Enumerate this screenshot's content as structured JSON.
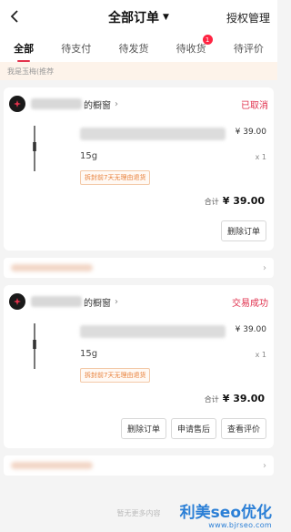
{
  "header": {
    "title": "全部订单",
    "auth_label": "授权管理"
  },
  "tabs": [
    {
      "label": "全部",
      "active": true
    },
    {
      "label": "待支付"
    },
    {
      "label": "待发货"
    },
    {
      "label": "待收货",
      "badge": "1"
    },
    {
      "label": "待评价"
    }
  ],
  "promo": {
    "text": "我是玉梅(推荐"
  },
  "orders": [
    {
      "shop_suffix": "的橱窗",
      "status": "已取消",
      "price": "¥ 39.00",
      "spec": "15g",
      "qty": "x 1",
      "tag": "拆封前7天无理由退货",
      "total_label": "合计",
      "total": "¥ 39.00",
      "actions": [
        "删除订单"
      ]
    },
    {
      "shop_suffix": "的橱窗",
      "status": "交易成功",
      "price": "¥ 39.00",
      "spec": "15g",
      "qty": "x 1",
      "tag": "拆封前7天无理由退货",
      "total_label": "合计",
      "total": "¥ 39.00",
      "actions": [
        "删除订单",
        "申请售后",
        "查看评价"
      ]
    }
  ],
  "footer": {
    "no_more": "暂无更多内容"
  },
  "watermark": {
    "main": "利美seo优化",
    "url": "www.bjrseo.com"
  }
}
